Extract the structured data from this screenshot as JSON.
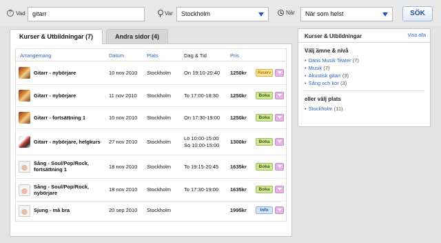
{
  "search": {
    "vad_label": "Vad",
    "vad_value": "gitarr",
    "var_label": "Var",
    "var_value": "Stockholm",
    "nar_label": "När",
    "nar_value": "När som helst",
    "button": "SÖK"
  },
  "tabs": [
    {
      "label": "Kurser & Utbildningar (7)",
      "active": true
    },
    {
      "label": "Andra sidor (4)",
      "active": false
    }
  ],
  "table": {
    "headers": [
      "Arrangemang",
      "Datum",
      "Plats",
      "Dag & Tid",
      "Pris"
    ],
    "rows": [
      {
        "image": "guitar",
        "name": "Gitarr - nybörjare",
        "name2": "",
        "date": "10 nov 2010",
        "place": "Stockholm",
        "time": "On 19:10-20:40",
        "time2": "",
        "price": "1250kr",
        "action": "Reserv",
        "action_type": "reserv"
      },
      {
        "image": "guitar",
        "name": "Gitarr - nybörjare",
        "name2": "",
        "date": "11 nov 2010",
        "place": "Stockholm",
        "time": "To 17:00-18:30",
        "time2": "",
        "price": "1250kr",
        "action": "Boka",
        "action_type": "boka"
      },
      {
        "image": "guitar",
        "name": "Gitarr - fortsättning 1",
        "name2": "",
        "date": "10 nov 2010",
        "place": "Stockholm",
        "time": "On 17:30-19:00",
        "time2": "",
        "price": "1250kr",
        "action": "Boka",
        "action_type": "boka"
      },
      {
        "image": "climb",
        "name": "Gitarr - nybörjare, helgkurs",
        "name2": "",
        "date": "27 nov 2010",
        "place": "Stockholm",
        "time": "Lö 10:00-15:00",
        "time2": "Sö 10:00-15:00",
        "price": "1300kr",
        "action": "Boka",
        "action_type": "boka"
      },
      {
        "image": "face",
        "name": "Sång - Soul/Pop/Rock,",
        "name2": "fortsättning 1",
        "date": "18 nov 2010",
        "place": "Stockholm",
        "time": "To 19:15-20:45",
        "time2": "",
        "price": "1635kr",
        "action": "Boka",
        "action_type": "boka"
      },
      {
        "image": "face",
        "name": "Sång - Soul/Pop/Rock,",
        "name2": "nybörjare",
        "date": "18 nov 2010",
        "place": "Stockholm",
        "time": "To 17:30-19:00",
        "time2": "",
        "price": "1635kr",
        "action": "Boka",
        "action_type": "boka"
      },
      {
        "image": "face",
        "name": "Sjung - må bra",
        "name2": "",
        "date": "20 sep 2010",
        "place": "Stockholm",
        "time": "",
        "time2": "",
        "price": "1995kr",
        "action": "Info",
        "action_type": "info"
      }
    ]
  },
  "sidebar": {
    "title": "Kurser & Utbildningar",
    "show_all": "Visa alla",
    "subject_heading": "Välj ämne & nivå",
    "subjects": [
      {
        "label": "Dans Musik Teater",
        "count": "(7)"
      },
      {
        "label": "Musik",
        "count": "(7)"
      },
      {
        "label": "Akustisk gitarr",
        "count": "(3)"
      },
      {
        "label": "Sång och kör",
        "count": "(3)"
      }
    ],
    "place_heading": "eller välj plats",
    "places": [
      {
        "label": "Stockholm",
        "count": "(11)"
      }
    ]
  }
}
